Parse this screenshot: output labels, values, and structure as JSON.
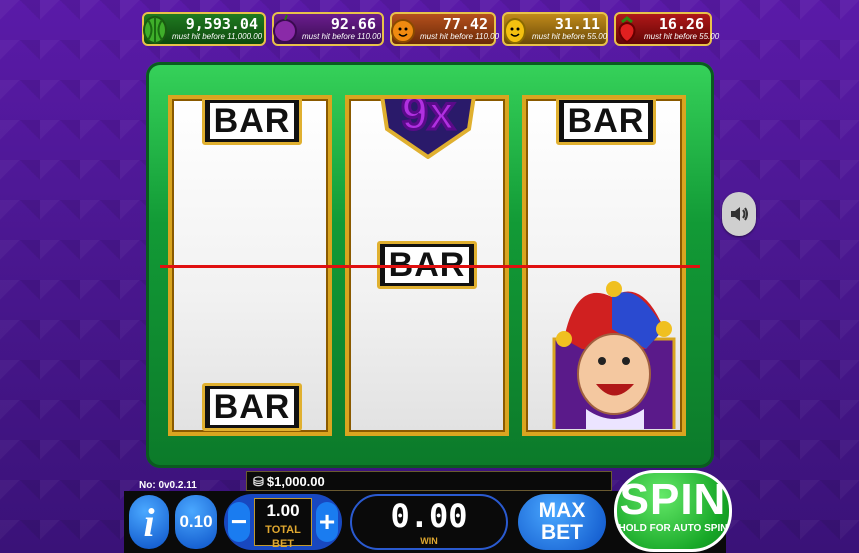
{
  "jackpots": [
    {
      "amount": "9,593.04",
      "note": "must hit before 11,000.00",
      "fruit_icon": "watermelon-icon",
      "color": "#1f7a20"
    },
    {
      "amount": "92.66",
      "note": "must hit before 110.00",
      "fruit_icon": "plum-icon",
      "color": "#6b1d8e"
    },
    {
      "amount": "77.42",
      "note": "must hit before 110.00",
      "fruit_icon": "orange-icon",
      "color": "#b5501c"
    },
    {
      "amount": "31.11",
      "note": "must hit before 55.00",
      "fruit_icon": "lemon-icon",
      "color": "#c08a1a"
    },
    {
      "amount": "16.26",
      "note": "must hit before 55.00",
      "fruit_icon": "cherry-icon",
      "color": "#b01818"
    }
  ],
  "reels": {
    "reel1": [
      "BAR",
      "BAR"
    ],
    "reel2": [
      "9x",
      "BAR"
    ],
    "reel3": [
      "BAR",
      "jester"
    ]
  },
  "balance": "$1,000.00",
  "version": "No: 0v0.2.11",
  "info_label": "i",
  "denomination": "0.10",
  "bet": {
    "minus": "−",
    "plus": "+",
    "value": "1.00",
    "label": "TOTAL BET"
  },
  "win": {
    "value": "0.00",
    "label": "WIN"
  },
  "max_bet": {
    "line1": "MAX",
    "line2": "BET"
  },
  "spin": {
    "label": "SPIN",
    "sub": "HOLD FOR AUTO SPIN"
  },
  "colors": {
    "frame_green": "#129a36",
    "gold": "#d9a520",
    "payline": "#e01010",
    "button_blue": "#0c52c8",
    "spin_green": "#18a828"
  }
}
